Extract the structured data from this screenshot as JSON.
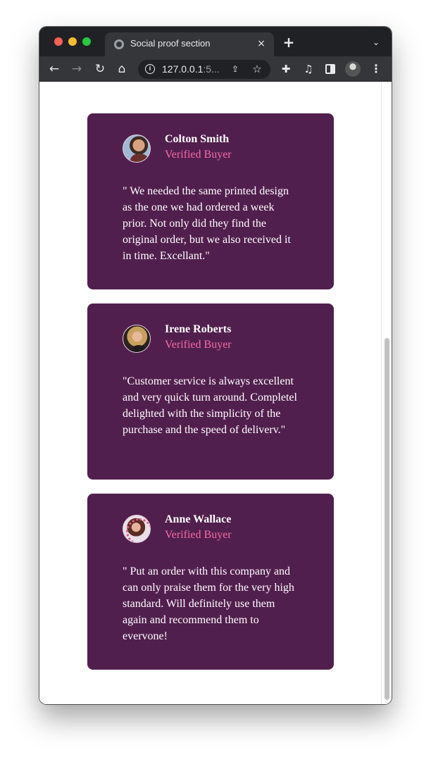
{
  "browser": {
    "tab_title": "Social proof section",
    "tab_close": "×",
    "new_tab": "+",
    "tab_menu": "⌄",
    "url_main": "127.0.0.1",
    "url_dim": ":5...",
    "nav": {
      "back": "←",
      "forward": "→",
      "reload": "↻",
      "home": "⌂",
      "share": "⇪",
      "star": "☆",
      "extensions": "✚",
      "media": "♫",
      "menu": "⋮"
    },
    "icons": [
      "globe-icon",
      "info-icon",
      "share-icon",
      "star-icon",
      "puzzle-icon",
      "media-icon",
      "side-panel-icon",
      "profile-icon",
      "kebab-icon"
    ]
  },
  "testimonials": [
    {
      "name": "Colton Smith",
      "role": "Verified Buyer",
      "quote": "\" We needed the same printed design as the one we had ordered a week prior. Not only did they find the original order, but we also received it in time. Excellant.\""
    },
    {
      "name": "Irene Roberts",
      "role": "Verified Buyer",
      "quote": "\"Customer service is always excellent and very quick turn around. Completel delighted with the simplicity of the purchase and the speed of deliverv.\""
    },
    {
      "name": "Anne Wallace",
      "role": "Verified Buyer",
      "quote": "\" Put an order with this company and can only praise them for the very high standard. Will definitely use them again and recommend them to evervone!"
    }
  ],
  "colors": {
    "card_background": "#511f4e",
    "role_accent": "#f66ca5",
    "text": "#ffffff"
  }
}
